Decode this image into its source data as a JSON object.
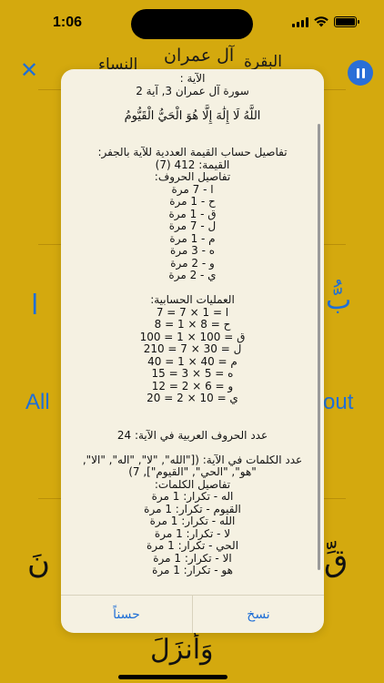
{
  "status": {
    "time": "1:06"
  },
  "nav": {
    "close_glyph": "✕",
    "tabs": [
      {
        "label": "النساء"
      },
      {
        "label": "آل عمران"
      },
      {
        "label": "البقرة"
      }
    ]
  },
  "background": {
    "arabic_left": "ا",
    "arabic_right": "بُّ",
    "english_left": "All",
    "english_right": "out",
    "arabic_big_left": "نَ",
    "arabic_big_right": "قِّ",
    "arabic_bottom": "وَأَنزَلَ"
  },
  "modal": {
    "lines": [
      "الآية :",
      "سورة آل عمران 3, آية 2",
      "",
      "اللَّهُ لَا إِلَٰهَ إِلَّا هُوَ الْحَيُّ الْقَيُّومُ",
      "",
      "",
      "تفاصيل حساب القيمة العددية للآية بالجفر:",
      "القيمة: 412 (7)",
      "تفاصيل الحروف:",
      "ا - 7 مرة",
      "ح - 1 مرة",
      "ق - 1 مرة",
      "ل - 7 مرة",
      "م - 1 مرة",
      "ه - 3 مرة",
      "و - 2 مرة",
      "ي - 2 مرة",
      "",
      "العمليات الحسابية:",
      "ا = 1 × 7 = 7",
      "ح = 8 × 1 = 8",
      "ق = 100 × 1 = 100",
      "ل = 30 × 7 = 210",
      "م = 40 × 1 = 40",
      "ه = 5 × 3 = 15",
      "و = 6 × 2 = 12",
      "ي = 10 × 2 = 20",
      "",
      "",
      "عدد الحروف العربية في الآية: 24",
      "",
      "عدد الكلمات في الآية: ([\"الله\", \"لا\", \"اله\", \"الا\",",
      "\"هو\", \"الحي\", \"القيوم\"], 7)",
      "تفاصيل الكلمات:",
      "اله - تكرار: 1 مرة",
      "القيوم - تكرار: 1 مرة",
      "الله - تكرار: 1 مرة",
      "لا - تكرار: 1 مرة",
      "الحي - تكرار: 1 مرة",
      "الا - تكرار: 1 مرة",
      "هو - تكرار: 1 مرة"
    ],
    "copy_label": "نسخ",
    "ok_label": "حسناً"
  }
}
